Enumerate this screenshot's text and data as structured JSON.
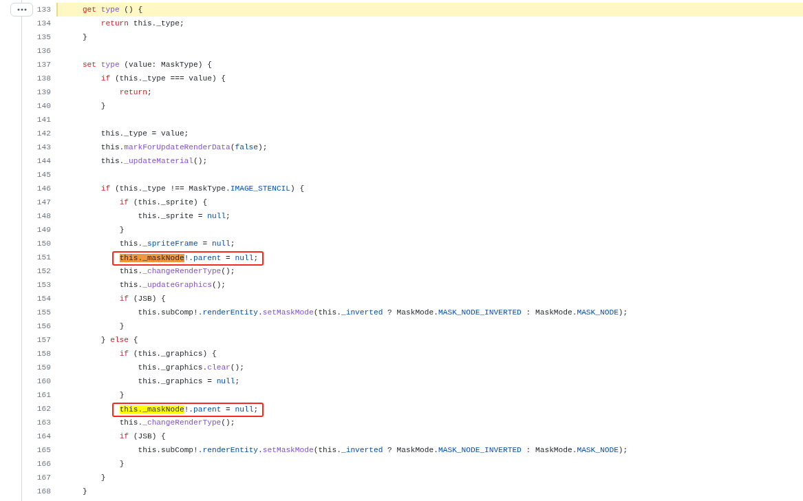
{
  "lines": [
    {
      "number": "133",
      "highlighted": true,
      "boxed": false,
      "tokens": [
        {
          "kind": "keyword",
          "t": "get "
        },
        {
          "kind": "function",
          "t": "type"
        },
        {
          "kind": "plain",
          "t": " () {"
        }
      ]
    },
    {
      "number": "134",
      "highlighted": false,
      "boxed": false,
      "tokens": [
        {
          "kind": "keyword",
          "t": "return"
        },
        {
          "kind": "plain",
          "t": " this._type;"
        }
      ]
    },
    {
      "number": "135",
      "highlighted": false,
      "boxed": false,
      "tokens": [
        {
          "kind": "plain",
          "t": "}"
        }
      ]
    },
    {
      "number": "136",
      "highlighted": false,
      "boxed": false
    },
    {
      "number": "137",
      "highlighted": false,
      "boxed": false,
      "tokens": [
        {
          "kind": "keyword",
          "t": "set "
        },
        {
          "kind": "function",
          "t": "type"
        },
        {
          "kind": "plain",
          "t": " (value: MaskType) {"
        }
      ]
    },
    {
      "number": "138",
      "highlighted": false,
      "boxed": false,
      "tokens": [
        {
          "kind": "keyword",
          "t": "if"
        },
        {
          "kind": "plain",
          "t": " (this._type === value) {"
        }
      ]
    },
    {
      "number": "139",
      "highlighted": false,
      "boxed": false,
      "tokens": [
        {
          "kind": "keyword",
          "t": "return"
        },
        {
          "kind": "plain",
          "t": ";"
        }
      ]
    },
    {
      "number": "140",
      "highlighted": false,
      "boxed": false,
      "tokens": [
        {
          "kind": "plain",
          "t": "}"
        }
      ]
    },
    {
      "number": "141",
      "highlighted": false,
      "boxed": false
    },
    {
      "number": "142",
      "highlighted": false,
      "boxed": false,
      "tokens": [
        {
          "kind": "plain",
          "t": "this._type = value;"
        }
      ]
    },
    {
      "number": "143",
      "highlighted": false,
      "boxed": false,
      "tokens": [
        {
          "kind": "plain",
          "t": "this."
        },
        {
          "kind": "function",
          "t": "markForUpdateRenderData"
        },
        {
          "kind": "plain",
          "t": "("
        },
        {
          "kind": "constant",
          "t": "false"
        },
        {
          "kind": "plain",
          "t": ");"
        }
      ]
    },
    {
      "number": "144",
      "highlighted": false,
      "boxed": false,
      "tokens": [
        {
          "kind": "plain",
          "t": "this."
        },
        {
          "kind": "function",
          "t": "_updateMaterial"
        },
        {
          "kind": "plain",
          "t": "();"
        }
      ]
    },
    {
      "number": "145",
      "highlighted": false,
      "boxed": false
    },
    {
      "number": "146",
      "highlighted": false,
      "boxed": false,
      "tokens": [
        {
          "kind": "keyword",
          "t": "if"
        },
        {
          "kind": "plain",
          "t": " (this._type !== MaskType."
        },
        {
          "kind": "constant",
          "t": "IMAGE_STENCIL"
        },
        {
          "kind": "plain",
          "t": ") {"
        }
      ]
    },
    {
      "number": "147",
      "highlighted": false,
      "boxed": false,
      "tokens": [
        {
          "kind": "keyword",
          "t": "if"
        },
        {
          "kind": "plain",
          "t": " (this._sprite) {"
        }
      ]
    },
    {
      "number": "148",
      "highlighted": false,
      "boxed": false,
      "tokens": [
        {
          "kind": "plain",
          "t": "this._sprite = "
        },
        {
          "kind": "constant",
          "t": "null"
        },
        {
          "kind": "plain",
          "t": ";"
        }
      ]
    },
    {
      "number": "149",
      "highlighted": false,
      "boxed": false,
      "tokens": [
        {
          "kind": "plain",
          "t": "}"
        }
      ]
    },
    {
      "number": "150",
      "highlighted": false,
      "boxed": false,
      "tokens": [
        {
          "kind": "plain",
          "t": "this."
        },
        {
          "kind": "constant",
          "t": "_spriteFrame"
        },
        {
          "kind": "plain",
          "t": " = "
        },
        {
          "kind": "constant",
          "t": "null"
        },
        {
          "kind": "plain",
          "t": ";"
        }
      ]
    },
    {
      "number": "151",
      "highlighted": false,
      "boxed": true,
      "tokens": [
        {
          "kind": "match",
          "current": true,
          "t": "this._maskNode"
        },
        {
          "kind": "plain",
          "t": "!."
        },
        {
          "kind": "constant",
          "t": "parent"
        },
        {
          "kind": "plain",
          "t": " = "
        },
        {
          "kind": "constant",
          "t": "null"
        },
        {
          "kind": "plain",
          "t": ";"
        }
      ]
    },
    {
      "number": "152",
      "highlighted": false,
      "boxed": false,
      "tokens": [
        {
          "kind": "plain",
          "t": "this."
        },
        {
          "kind": "function",
          "t": "_changeRenderType"
        },
        {
          "kind": "plain",
          "t": "();"
        }
      ]
    },
    {
      "number": "153",
      "highlighted": false,
      "boxed": false,
      "tokens": [
        {
          "kind": "plain",
          "t": "this."
        },
        {
          "kind": "function",
          "t": "_updateGraphics"
        },
        {
          "kind": "plain",
          "t": "();"
        }
      ]
    },
    {
      "number": "154",
      "highlighted": false,
      "boxed": false,
      "tokens": [
        {
          "kind": "keyword",
          "t": "if"
        },
        {
          "kind": "plain",
          "t": " (JSB) {"
        }
      ]
    },
    {
      "number": "155",
      "highlighted": false,
      "boxed": false,
      "tokens": [
        {
          "kind": "plain",
          "t": "this.subComp!."
        },
        {
          "kind": "constant",
          "t": "renderEntity"
        },
        {
          "kind": "plain",
          "t": "."
        },
        {
          "kind": "function",
          "t": "setMaskMode"
        },
        {
          "kind": "plain",
          "t": "(this."
        },
        {
          "kind": "constant",
          "t": "_inverted"
        },
        {
          "kind": "plain",
          "t": " ? MaskMode."
        },
        {
          "kind": "constant",
          "t": "MASK_NODE_INVERTED"
        },
        {
          "kind": "plain",
          "t": " : MaskMode."
        },
        {
          "kind": "constant",
          "t": "MASK_NODE"
        },
        {
          "kind": "plain",
          "t": ");"
        }
      ]
    },
    {
      "number": "156",
      "highlighted": false,
      "boxed": false,
      "tokens": [
        {
          "kind": "plain",
          "t": "}"
        }
      ]
    },
    {
      "number": "157",
      "highlighted": false,
      "boxed": false,
      "tokens": [
        {
          "kind": "plain",
          "t": "} "
        },
        {
          "kind": "keyword",
          "t": "else"
        },
        {
          "kind": "plain",
          "t": " {"
        }
      ]
    },
    {
      "number": "158",
      "highlighted": false,
      "boxed": false,
      "tokens": [
        {
          "kind": "keyword",
          "t": "if"
        },
        {
          "kind": "plain",
          "t": " (this._graphics) {"
        }
      ]
    },
    {
      "number": "159",
      "highlighted": false,
      "boxed": false,
      "tokens": [
        {
          "kind": "plain",
          "t": "this._graphics."
        },
        {
          "kind": "function",
          "t": "clear"
        },
        {
          "kind": "plain",
          "t": "();"
        }
      ]
    },
    {
      "number": "160",
      "highlighted": false,
      "boxed": false,
      "tokens": [
        {
          "kind": "plain",
          "t": "this._graphics = "
        },
        {
          "kind": "constant",
          "t": "null"
        },
        {
          "kind": "plain",
          "t": ";"
        }
      ]
    },
    {
      "number": "161",
      "highlighted": false,
      "boxed": false,
      "tokens": [
        {
          "kind": "plain",
          "t": "}"
        }
      ]
    },
    {
      "number": "162",
      "highlighted": false,
      "boxed": true,
      "tokens": [
        {
          "kind": "match",
          "current": false,
          "t": "this._maskNode"
        },
        {
          "kind": "plain",
          "t": "!."
        },
        {
          "kind": "constant",
          "t": "parent"
        },
        {
          "kind": "plain",
          "t": " = "
        },
        {
          "kind": "constant",
          "t": "null"
        },
        {
          "kind": "plain",
          "t": ";"
        }
      ]
    },
    {
      "number": "163",
      "highlighted": false,
      "boxed": false,
      "tokens": [
        {
          "kind": "plain",
          "t": "this."
        },
        {
          "kind": "function",
          "t": "_changeRenderType"
        },
        {
          "kind": "plain",
          "t": "();"
        }
      ]
    },
    {
      "number": "164",
      "highlighted": false,
      "boxed": false,
      "tokens": [
        {
          "kind": "keyword",
          "t": "if"
        },
        {
          "kind": "plain",
          "t": " (JSB) {"
        }
      ]
    },
    {
      "number": "165",
      "highlighted": false,
      "boxed": false,
      "tokens": [
        {
          "kind": "plain",
          "t": "this.subComp!."
        },
        {
          "kind": "constant",
          "t": "renderEntity"
        },
        {
          "kind": "plain",
          "t": "."
        },
        {
          "kind": "function",
          "t": "setMaskMode"
        },
        {
          "kind": "plain",
          "t": "(this."
        },
        {
          "kind": "constant",
          "t": "_inverted"
        },
        {
          "kind": "plain",
          "t": " ? MaskMode."
        },
        {
          "kind": "constant",
          "t": "MASK_NODE_INVERTED"
        },
        {
          "kind": "plain",
          "t": " : MaskMode."
        },
        {
          "kind": "constant",
          "t": "MASK_NODE"
        },
        {
          "kind": "plain",
          "t": ");"
        }
      ]
    },
    {
      "number": "166",
      "highlighted": false,
      "boxed": false,
      "tokens": [
        {
          "kind": "plain",
          "t": "}"
        }
      ]
    },
    {
      "number": "167",
      "highlighted": false,
      "boxed": false,
      "tokens": [
        {
          "kind": "plain",
          "t": "}"
        }
      ]
    },
    {
      "number": "168",
      "highlighted": false,
      "boxed": false,
      "tokens": [
        {
          "kind": "plain",
          "t": "}"
        }
      ]
    }
  ]
}
